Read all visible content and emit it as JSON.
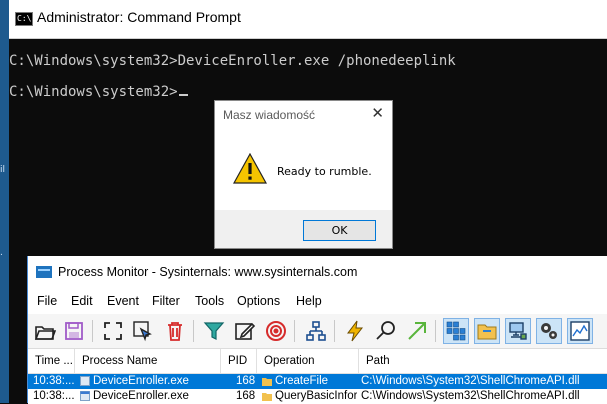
{
  "cmd": {
    "title": "Administrator: Command Prompt",
    "icon_text": "C:\\.",
    "lines": [
      "C:\\Windows\\system32>DeviceEnroller.exe /phonedeeplink",
      "C:\\Windows\\system32>"
    ]
  },
  "dialog": {
    "title": "Masz wiadomość",
    "close_glyph": "✕",
    "message": "Ready to rumble.",
    "ok_label": "OK"
  },
  "procmon": {
    "title": "Process Monitor - Sysinternals: www.sysinternals.com",
    "menu": [
      "File",
      "Edit",
      "Event",
      "Filter",
      "Tools",
      "Options",
      "Help"
    ],
    "toolbar_icons": [
      "open-icon",
      "save-icon",
      "capture-icon",
      "autoscroll-icon",
      "clear-icon",
      "filter-icon",
      "highlight-icon",
      "target-icon",
      "process-tree-icon",
      "find-icon",
      "jump-icon",
      "search-icon",
      "registry-icon",
      "filesystem-icon",
      "network-icon",
      "process-activity-icon",
      "profiling-icon"
    ],
    "columns": [
      "Time ...",
      "Process Name",
      "PID",
      "Operation",
      "Path"
    ],
    "rows": [
      {
        "time": "10:38:...",
        "process": "DeviceEnroller.exe",
        "pid": "168",
        "operation": "CreateFile",
        "path": "C:\\Windows\\System32\\ShellChromeAPI.dll",
        "selected": true
      },
      {
        "time": "10:38:...",
        "process": "DeviceEnroller.exe",
        "pid": "168",
        "operation": "QueryBasicInfor...",
        "path": "C:\\Windows\\System32\\ShellChromeAPI.dll",
        "selected": false
      }
    ]
  },
  "colors": {
    "selection": "#0078d7",
    "console_bg": "#0c0c0c",
    "console_text": "#cccccc"
  }
}
